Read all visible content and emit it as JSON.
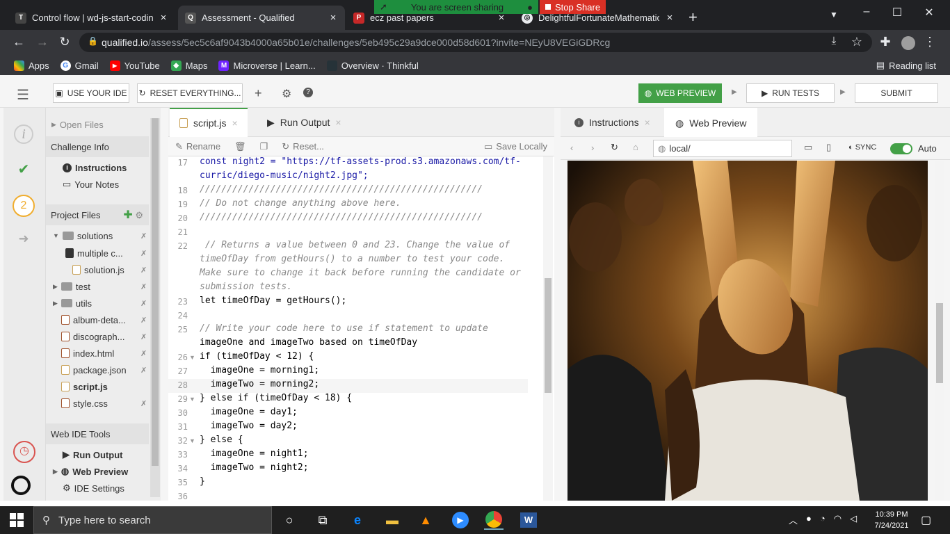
{
  "browser": {
    "tabs": [
      {
        "title": "Control flow | wd-js-start-coding",
        "close": "×"
      },
      {
        "title": "Assessment - Qualified",
        "close": "×"
      },
      {
        "title": "ecz past papers",
        "close": "×"
      },
      {
        "title": "DelightfulFortunateMathematics",
        "close": "×"
      }
    ],
    "new_tab": "+",
    "sharing_text": "You are screen sharing",
    "stop_share": "Stop Share",
    "url_host": "qualified.io",
    "url_path": "/assess/5ec5c6af9043b4000a65b01e/challenges/5eb495c29a9dce000d58d601?invite=NEyU8VEGiGDRcg",
    "bookmarks": [
      "Apps",
      "Gmail",
      "YouTube",
      "Maps",
      "Microverse | Learn...",
      "Overview · Thinkful"
    ],
    "reading_list": "Reading list"
  },
  "ide": {
    "use_your_ide": "USE YOUR IDE",
    "reset_everything": "RESET EVERYTHING...",
    "web_preview": "WEB PREVIEW",
    "run_tests": "RUN TESTS",
    "submit": "SUBMIT",
    "step_number": "2",
    "sidebar": {
      "open_files": "Open Files",
      "challenge_info": "Challenge Info",
      "instructions": "Instructions",
      "your_notes": "Your Notes",
      "project_files": "Project Files",
      "files": [
        {
          "name": "solutions"
        },
        {
          "name": "multiple c..."
        },
        {
          "name": "solution.js"
        },
        {
          "name": "test"
        },
        {
          "name": "utils"
        },
        {
          "name": "album-deta..."
        },
        {
          "name": "discograph..."
        },
        {
          "name": "index.html"
        },
        {
          "name": "package.json"
        },
        {
          "name": "script.js"
        },
        {
          "name": "style.css"
        }
      ],
      "web_ide_tools": "Web IDE Tools",
      "run_output": "Run Output",
      "web_preview": "Web Preview",
      "ide_settings": "IDE Settings"
    },
    "editor": {
      "tab_script": "script.js",
      "tab_run_output": "Run Output",
      "rename": "Rename",
      "reset": "Reset...",
      "save_locally": "Save Locally",
      "lines": [
        {
          "n": "17",
          "text": "const night2 = \"https://tf-assets-prod.s3.amazonaws.com/tf-"
        },
        {
          "n": "",
          "text": "curric/diego-music/night2.jpg\";"
        },
        {
          "n": "18",
          "text": "////////////////////////////////////////////////////"
        },
        {
          "n": "19",
          "text": "// Do not change anything above here."
        },
        {
          "n": "20",
          "text": "////////////////////////////////////////////////////"
        },
        {
          "n": "21",
          "text": ""
        },
        {
          "n": "22",
          "text": " // Returns a value between 0 and 23. Change the value of"
        },
        {
          "n": "",
          "text": "timeOfDay from getHours() to a number to test your code."
        },
        {
          "n": "",
          "text": "Make sure to change it back before running the candidate or"
        },
        {
          "n": "",
          "text": "submission tests."
        },
        {
          "n": "23",
          "text": "let timeOfDay = getHours();"
        },
        {
          "n": "24",
          "text": ""
        },
        {
          "n": "25",
          "text": "// Write your code here to use if statement to update"
        },
        {
          "n": "",
          "text": "imageOne and imageTwo based on timeOfDay"
        },
        {
          "n": "26",
          "text": "if (timeOfDay < 12) {"
        },
        {
          "n": "27",
          "text": "  imageOne = morning1;"
        },
        {
          "n": "28",
          "text": "  imageTwo = morning2;"
        },
        {
          "n": "29",
          "text": "} else if (timeOfDay < 18) {"
        },
        {
          "n": "30",
          "text": "  imageOne = day1;"
        },
        {
          "n": "31",
          "text": "  imageTwo = day2;"
        },
        {
          "n": "32",
          "text": "} else {"
        },
        {
          "n": "33",
          "text": "  imageOne = night1;"
        },
        {
          "n": "34",
          "text": "  imageTwo = night2;"
        },
        {
          "n": "35",
          "text": "}"
        },
        {
          "n": "36",
          "text": ""
        }
      ]
    },
    "right_panel": {
      "tab_instructions": "Instructions",
      "tab_web_preview": "Web Preview",
      "url": "local/",
      "sync": "SYNC",
      "auto": "Auto"
    }
  },
  "taskbar": {
    "search_placeholder": "Type here to search",
    "time": "10:39 PM",
    "date": "7/24/2021"
  }
}
